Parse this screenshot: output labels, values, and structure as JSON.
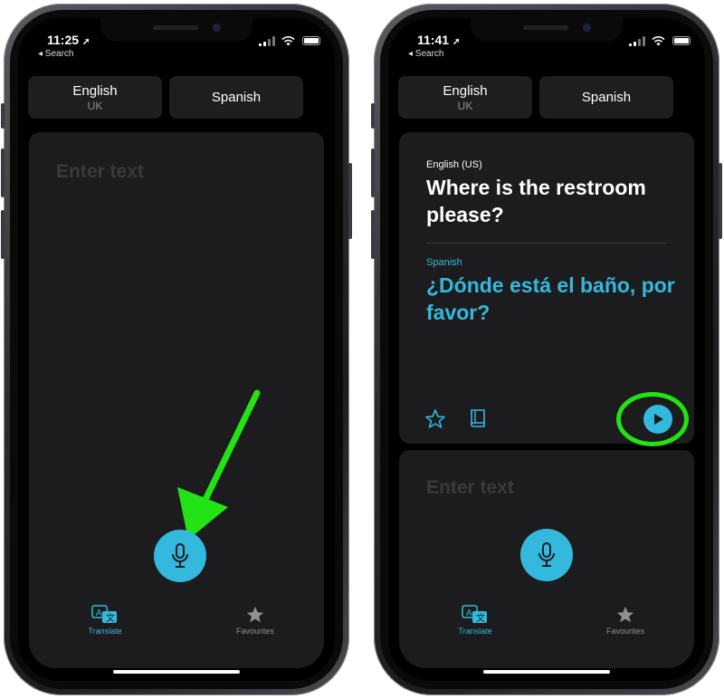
{
  "colors": {
    "accent": "#32b9dd",
    "annotation": "#22e313",
    "card": "#1c1c1e",
    "placeholder": "#3a3a3c"
  },
  "left_phone": {
    "status": {
      "time": "11:25",
      "back_label": "◂ Search"
    },
    "languages": {
      "source": "English",
      "source_region": "UK",
      "target": "Spanish"
    },
    "input": {
      "placeholder": "Enter text"
    },
    "tabs": {
      "translate": "Translate",
      "favourites": "Favourites"
    }
  },
  "right_phone": {
    "status": {
      "time": "11:41",
      "back_label": "◂ Search"
    },
    "languages": {
      "source": "English",
      "source_region": "UK",
      "target": "Spanish"
    },
    "translation": {
      "source_language": "English (US)",
      "source_text": "Where is the restroom please?",
      "target_language": "Spanish",
      "target_text": "¿Dónde está el baño, por favor?"
    },
    "input": {
      "placeholder": "Enter text"
    },
    "tabs": {
      "translate": "Translate",
      "favourites": "Favourites"
    }
  },
  "icons": [
    "microphone-icon",
    "play-icon",
    "star-icon",
    "book-icon",
    "translate-icon",
    "wifi-icon",
    "battery-icon",
    "location-arrow-icon"
  ]
}
